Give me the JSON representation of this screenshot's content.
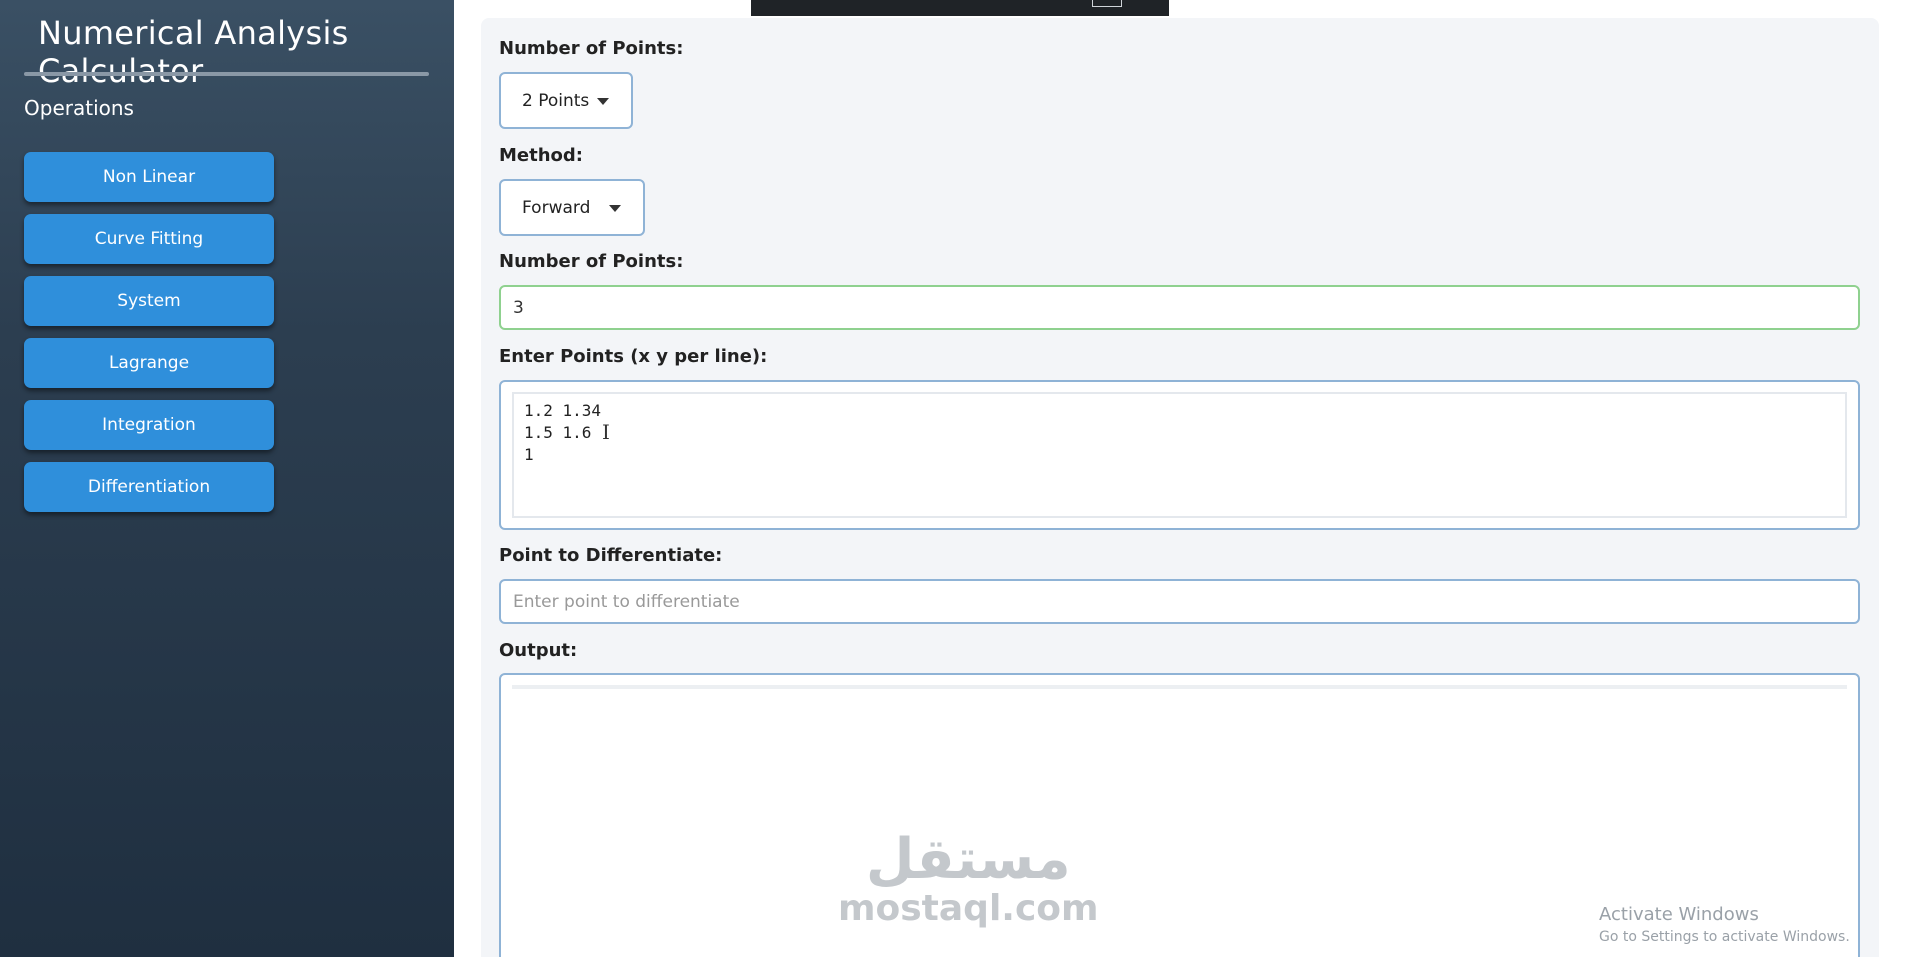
{
  "app": {
    "title": "Numerical Analysis Calculator"
  },
  "sidebar": {
    "section_label": "Operations",
    "items": [
      {
        "label": "Non Linear"
      },
      {
        "label": "Curve Fitting"
      },
      {
        "label": "System"
      },
      {
        "label": "Lagrange"
      },
      {
        "label": "Integration"
      },
      {
        "label": "Differentiation"
      }
    ]
  },
  "form": {
    "points_select": {
      "label": "Number of Points:",
      "value": "2 Points"
    },
    "method_select": {
      "label": "Method:",
      "value": "Forward"
    },
    "num_points": {
      "label": "Number of Points:",
      "value": "3"
    },
    "points_entry": {
      "label": "Enter Points (x y per line):",
      "value": "1.2 1.34\n1.5 1.6\n1"
    },
    "diff_point": {
      "label": "Point to Differentiate:",
      "placeholder": "Enter point to differentiate"
    },
    "output": {
      "label": "Output:",
      "value": ""
    }
  },
  "overlay": {
    "watermark_arabic": "مستقل",
    "watermark_latin": "mostaql.com",
    "activate_title": "Activate Windows",
    "activate_sub": "Go to Settings to activate Windows."
  },
  "colors": {
    "accent": "#2f8fdb",
    "sidebar_bg": "#2c3e50",
    "valid_border": "#8fd18f",
    "input_border": "#8fb3d6"
  }
}
